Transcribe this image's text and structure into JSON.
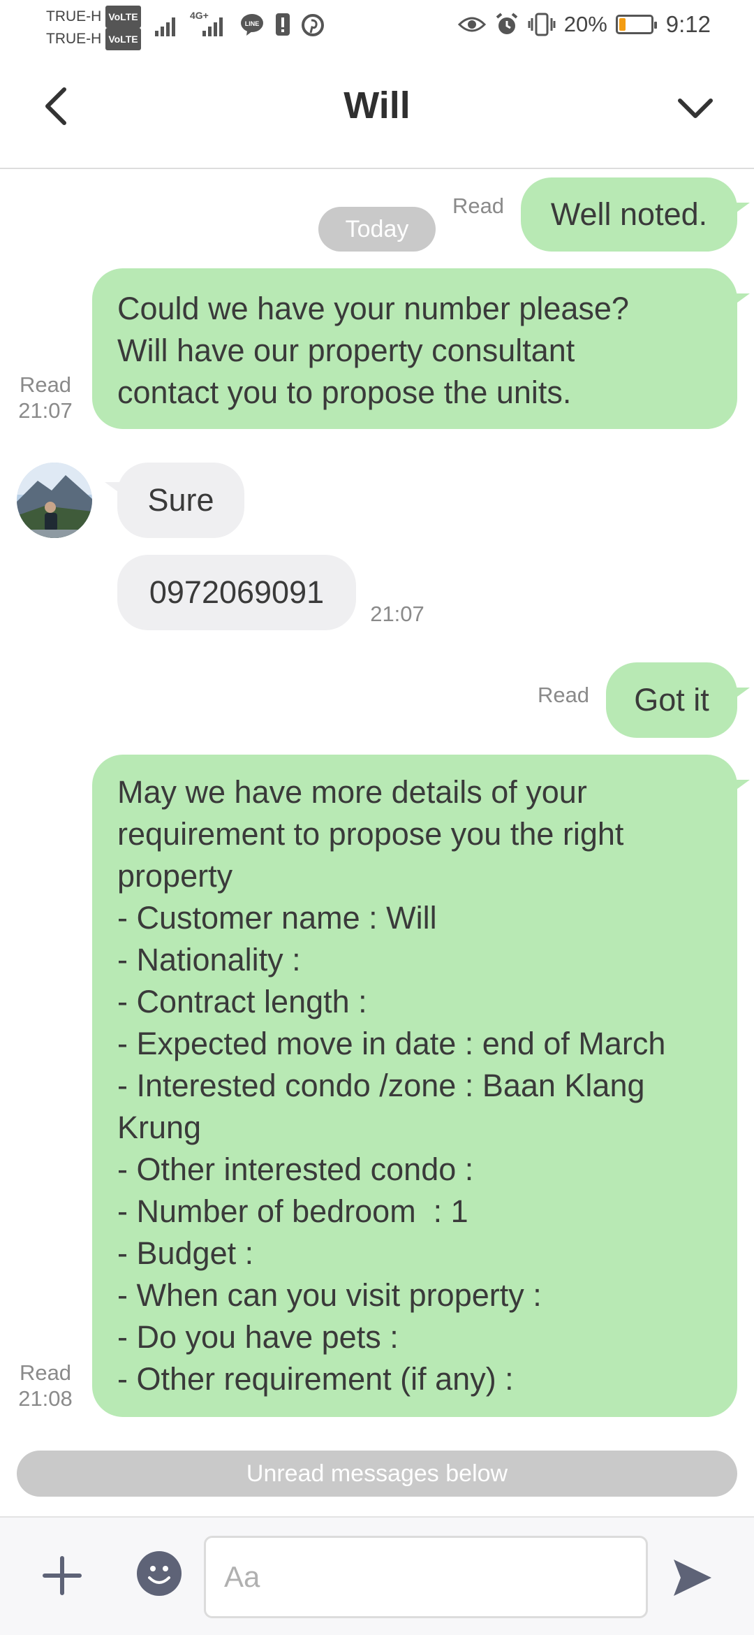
{
  "status_bar": {
    "carrier_1": "TRUE-H",
    "carrier_2": "TRUE-H",
    "volte": "VoLTE",
    "network": "4G+",
    "battery": "20%",
    "battery_level": 0.2,
    "time": "9:12"
  },
  "header": {
    "title": "Will"
  },
  "chat": {
    "date_separator": "Today",
    "messages": [
      {
        "direction": "outgoing",
        "text": "Well noted.",
        "status": "Read",
        "time": ""
      },
      {
        "direction": "outgoing",
        "lines": [
          "Could we have your number please?",
          "Will have our property consultant",
          "contact you to propose the units."
        ],
        "status": "Read",
        "time": "21:07"
      },
      {
        "direction": "incoming",
        "text": "Sure"
      },
      {
        "direction": "incoming",
        "text": "0972069091",
        "time": "21:07"
      },
      {
        "direction": "outgoing",
        "text": "Got it",
        "status": "Read",
        "time": ""
      },
      {
        "direction": "outgoing",
        "lines": [
          "May we have more details of your",
          "requirement to propose you the right",
          "property",
          "- Customer name : Will",
          "- Nationality :",
          "- Contract length :",
          "- Expected move in date : end of March",
          "- Interested condo /zone : Baan Klang",
          "Krung",
          "- Other interested condo :",
          "- Number of bedroom  : 1",
          "- Budget :",
          "- When can you visit property :",
          "- Do you have pets :",
          "- Other requirement (if any) :"
        ],
        "status": "Read",
        "time": "21:08"
      }
    ],
    "unread_banner": "Unread messages below"
  },
  "input_bar": {
    "placeholder": "Aa",
    "value": ""
  },
  "colors": {
    "outgoing_bubble": "#b8e9b4",
    "incoming_bubble": "#efeff1",
    "pill": "#c9c9c9",
    "battery": "#f39c12",
    "icon": "#5e6377"
  },
  "icons": [
    "back-icon",
    "chevron-down-icon",
    "plus-icon",
    "emoji-icon",
    "send-icon",
    "eye-icon",
    "alarm-icon",
    "vibrate-icon",
    "battery-icon",
    "signal-icon",
    "line-app-icon",
    "pinterest-icon"
  ]
}
